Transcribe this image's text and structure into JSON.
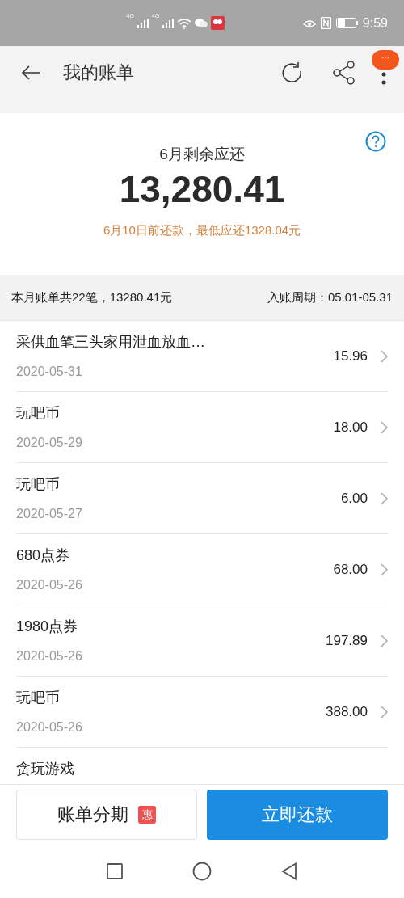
{
  "status_bar": {
    "networks": [
      "4G",
      "4G"
    ],
    "time": "9:59"
  },
  "header": {
    "title": "我的账单",
    "badge": "···"
  },
  "summary": {
    "label": "6月剩余应还",
    "amount": "13,280.41",
    "due_note": "6月10日前还款，最低应还1328.04元"
  },
  "info_bar": {
    "count": "本月账单共22笔，13280.41元",
    "period": "入账周期：05.01-05.31"
  },
  "bills": [
    {
      "title": "采供血笔三头家用泄血放血…",
      "date": "2020-05-31",
      "amount": "15.96"
    },
    {
      "title": "玩吧币",
      "date": "2020-05-29",
      "amount": "18.00"
    },
    {
      "title": "玩吧币",
      "date": "2020-05-27",
      "amount": "6.00"
    },
    {
      "title": "680点券",
      "date": "2020-05-26",
      "amount": "68.00"
    },
    {
      "title": "1980点券",
      "date": "2020-05-26",
      "amount": "197.89"
    },
    {
      "title": "玩吧币",
      "date": "2020-05-26",
      "amount": "388.00"
    },
    {
      "title": "贪玩游戏"
    }
  ],
  "actions": {
    "installment": "账单分期",
    "installment_tag": "惠",
    "pay": "立即还款"
  }
}
